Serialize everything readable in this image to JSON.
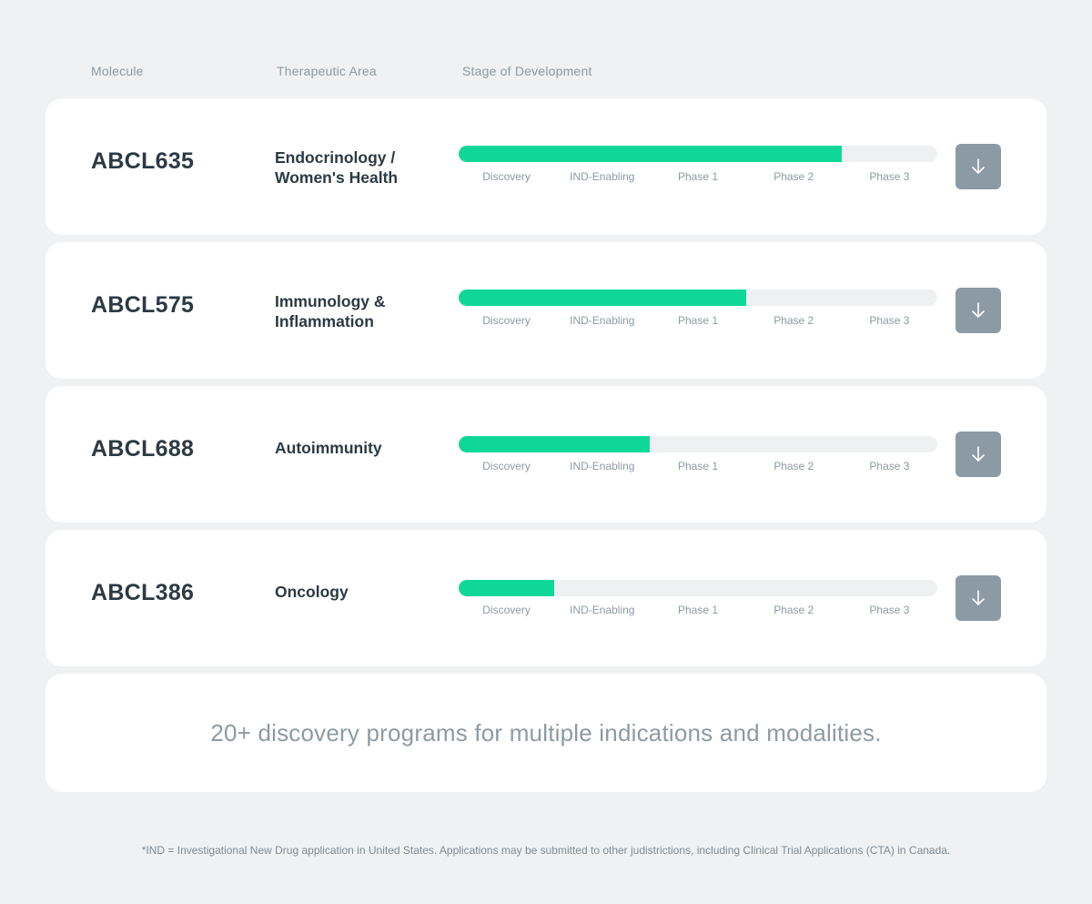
{
  "header": {
    "molecule": "Molecule",
    "therapeutic_area": "Therapeutic Area",
    "stage": "Stage of Development"
  },
  "phases": [
    "Discovery",
    "IND-Enabling",
    "Phase 1",
    "Phase 2",
    "Phase 3"
  ],
  "programs": [
    {
      "molecule": "ABCL635",
      "area_line1": "Endocrinology /",
      "area_line2": "Women's Health",
      "progress": 0.8
    },
    {
      "molecule": "ABCL575",
      "area_line1": "Immunology &",
      "area_line2": "Inflammation",
      "progress": 0.6
    },
    {
      "molecule": "ABCL688",
      "area_line1": "Autoimmunity",
      "area_line2": "",
      "progress": 0.4
    },
    {
      "molecule": "ABCL386",
      "area_line1": "Oncology",
      "area_line2": "",
      "progress": 0.2
    }
  ],
  "summary": "20+ discovery programs for multiple indications and modalities.",
  "footnote": "*IND = Investigational New Drug application in United States. Applications may be submitted to other judistrictions, including Clinical Trial Applications (CTA) in Canada.",
  "colors": {
    "accent_fill": "#0fd897",
    "track": "#eef0f2",
    "button": "#8c9aa6"
  },
  "icons": {
    "download": "arrow-down-icon"
  }
}
